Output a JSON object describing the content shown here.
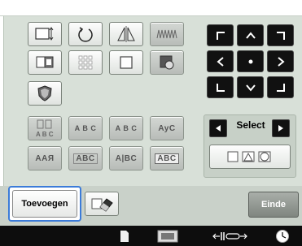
{
  "buttons": {
    "select_label": "Select",
    "add_label": "Toevoegen",
    "end_label": "Einde"
  },
  "text_samples": {
    "arc_up": "A B C",
    "straight": "A B C",
    "spacing": "A B C",
    "scissors_text": "AyC",
    "bold_text": "AAЯ",
    "box_text": "ABC",
    "boundary_text": "A|BC",
    "frame_text": "ABC"
  },
  "colors": {
    "accent": "#3b7bd9",
    "panel": "#d8e0d8",
    "nav": "#111111"
  },
  "icons": {
    "row1": [
      "resize-icon",
      "rotate-icon",
      "mirror-icon",
      "density-icon"
    ],
    "row2": [
      "border-icon",
      "array-icon",
      "outline-icon",
      "color-icon"
    ],
    "row3": [
      "applique-icon"
    ],
    "row4": [
      "text-array-icon",
      "arc-text-icon",
      "straight-text-icon",
      "spacing-text-icon"
    ],
    "row5": [
      "bold-text-icon",
      "box-text-icon",
      "text-boundary-icon",
      "frame-text-icon"
    ],
    "nav": [
      "nav-up-left",
      "nav-up",
      "nav-up-right",
      "nav-left",
      "nav-center",
      "nav-right",
      "nav-down-left",
      "nav-down",
      "nav-down-right"
    ],
    "status": [
      "memory-icon",
      "hoop-icon",
      "stitch-icon",
      "clock-icon"
    ]
  }
}
